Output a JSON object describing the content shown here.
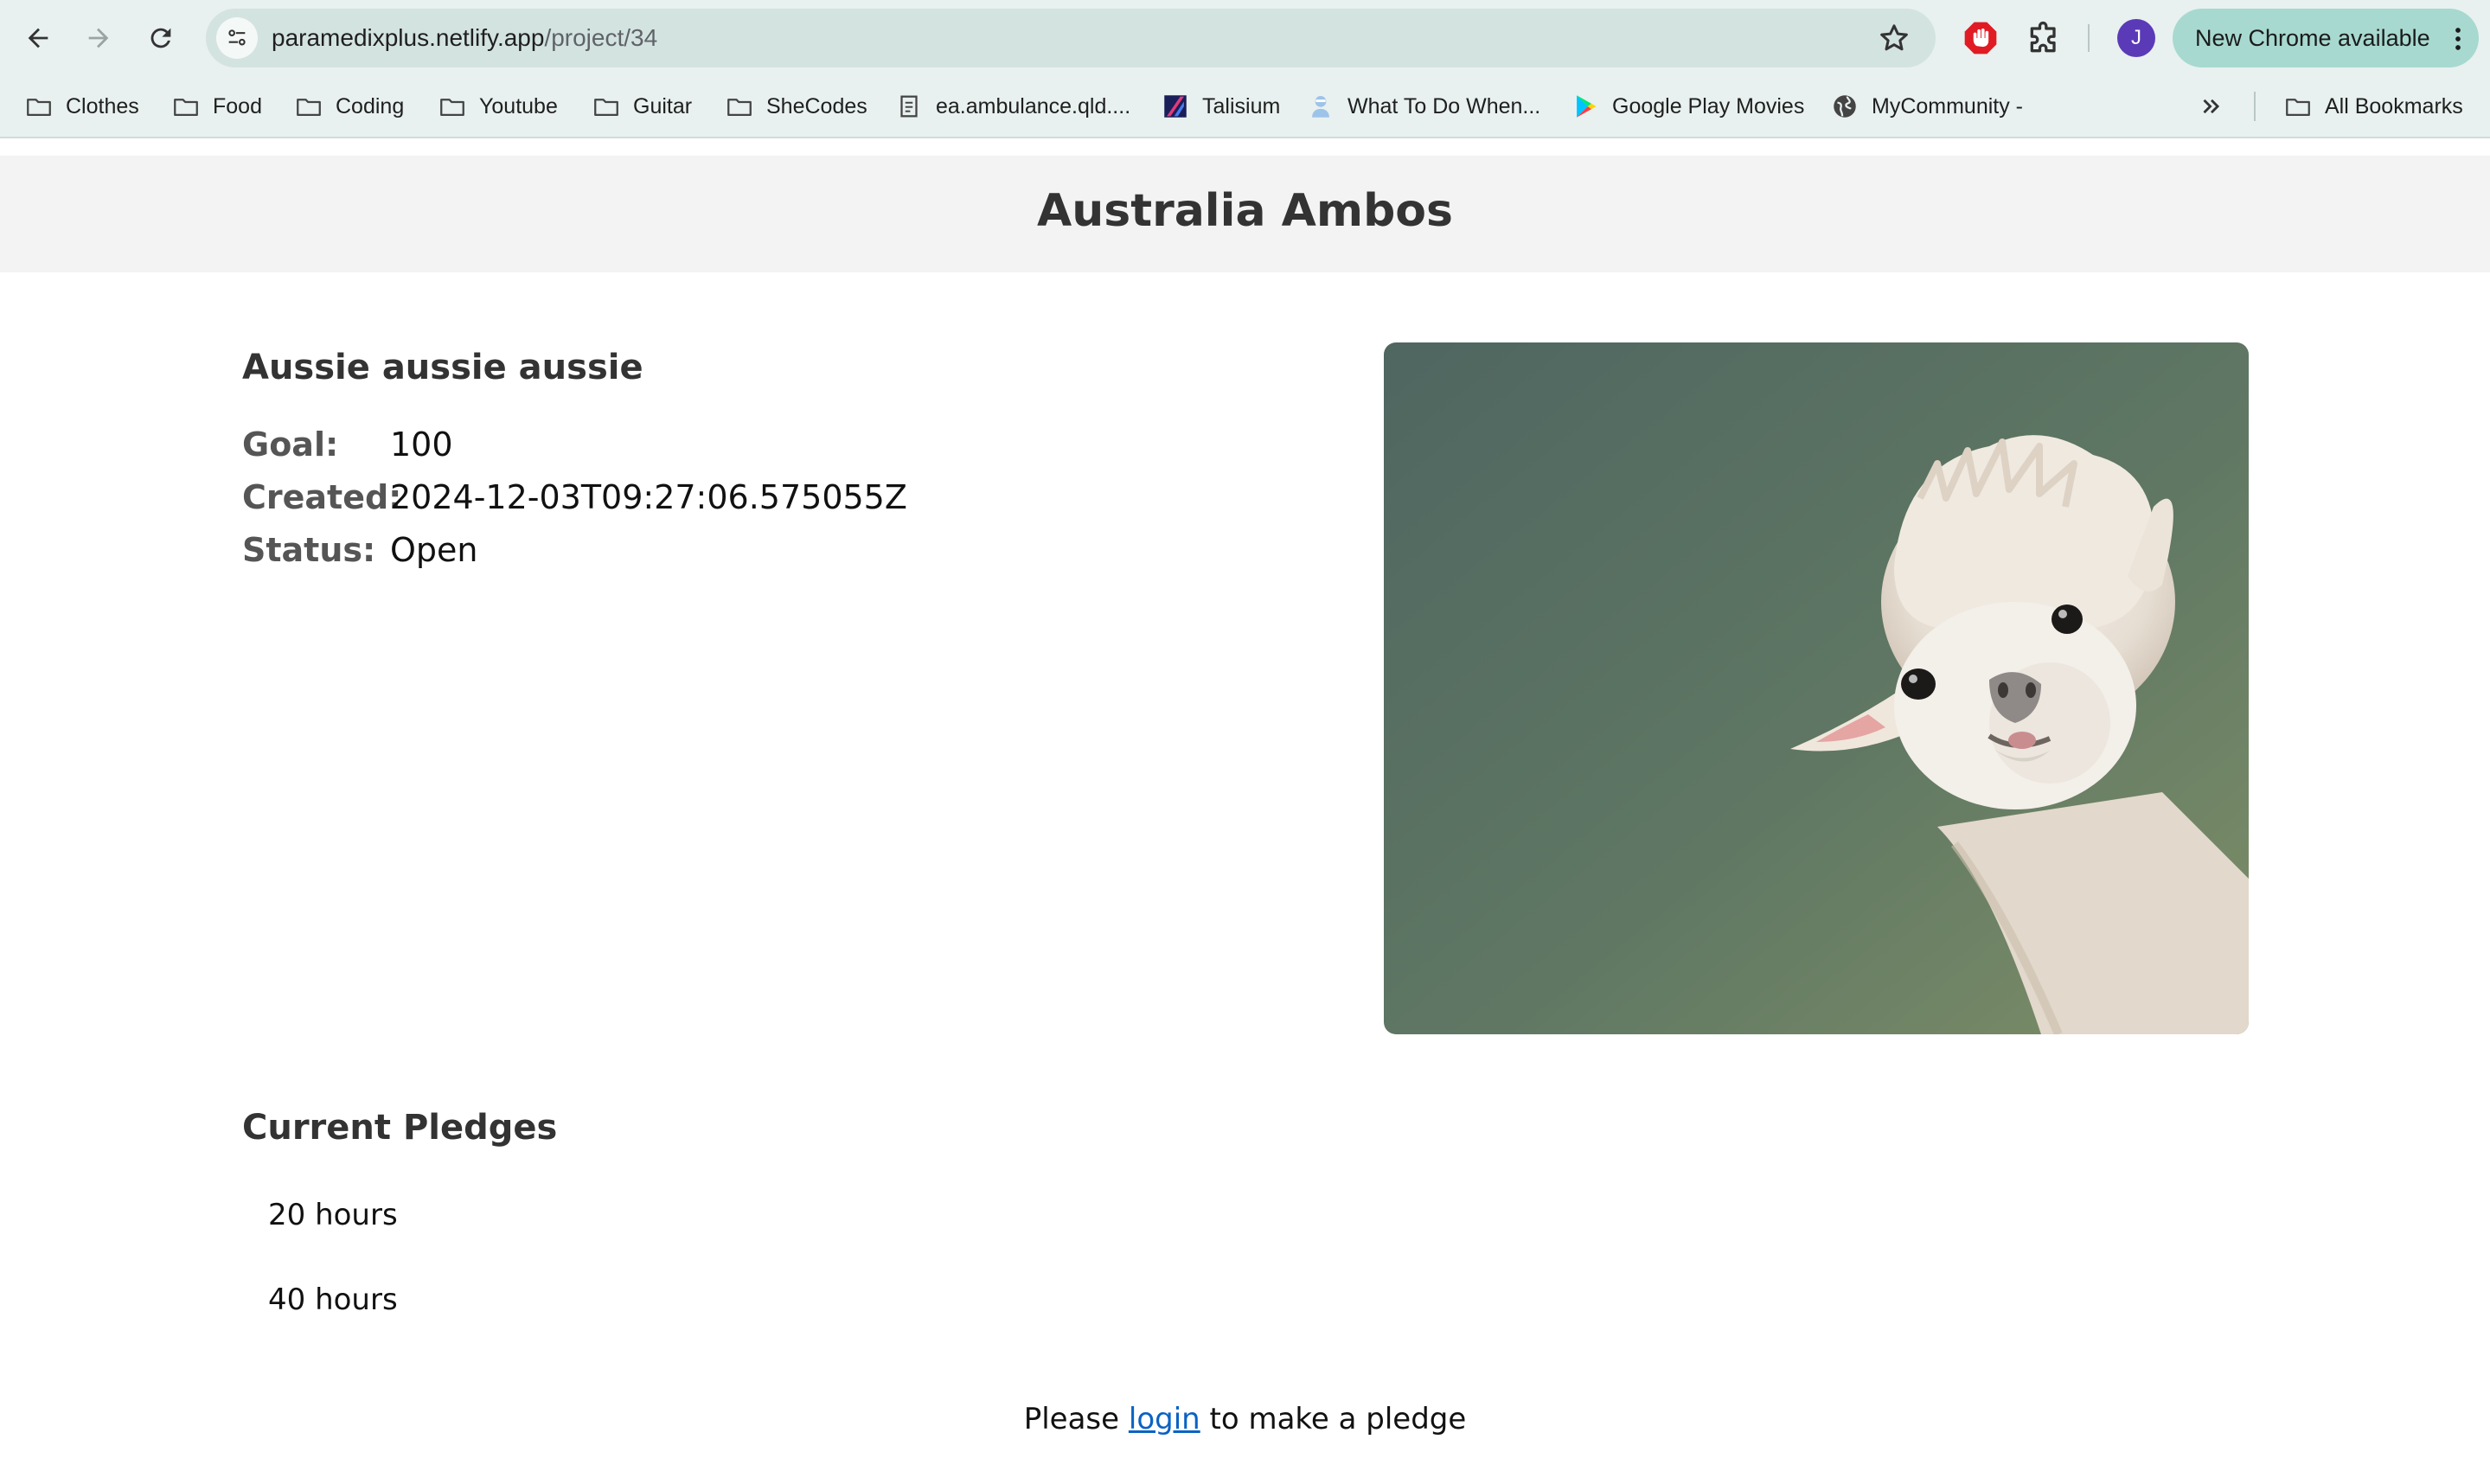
{
  "browser": {
    "url_host": "paramedixplus.netlify.app",
    "url_path": "/project/34",
    "avatar_initial": "J",
    "update_label": "New Chrome available",
    "bookmarks": [
      {
        "label": "Clothes",
        "icon": "folder-icon"
      },
      {
        "label": "Food",
        "icon": "folder-icon"
      },
      {
        "label": "Coding",
        "icon": "folder-icon"
      },
      {
        "label": "Youtube",
        "icon": "folder-icon"
      },
      {
        "label": "Guitar",
        "icon": "folder-icon"
      },
      {
        "label": "SheCodes",
        "icon": "folder-icon"
      },
      {
        "label": "ea.ambulance.qld....",
        "icon": "document-icon"
      },
      {
        "label": "Talisium",
        "icon": "talisium-icon"
      },
      {
        "label": "What To Do When...",
        "icon": "person-icon"
      },
      {
        "label": "Google Play Movies",
        "icon": "play-icon"
      },
      {
        "label": "MyCommunity -",
        "icon": "globe-icon"
      }
    ],
    "all_bookmarks_label": "All Bookmarks"
  },
  "page": {
    "header_title": "Australia Ambos",
    "project": {
      "title": "Aussie aussie aussie",
      "details": [
        {
          "key": "Goal:",
          "value": "100"
        },
        {
          "key": "Created:",
          "value": "2024-12-03T09:27:06.575055Z"
        },
        {
          "key": "Status:",
          "value": "Open"
        }
      ]
    },
    "pledges_title": "Current Pledges",
    "pledges": [
      "20 hours",
      "40 hours"
    ],
    "login_prompt": {
      "before": "Please ",
      "link": "login",
      "after": " to make a pledge"
    }
  },
  "colors": {
    "chrome_bg": "#e8f1ef",
    "omnibox_bg": "#d3e3e0",
    "update_pill": "#a7d9d0",
    "link": "#0b62c4",
    "header_bg": "#f3f3f3"
  }
}
